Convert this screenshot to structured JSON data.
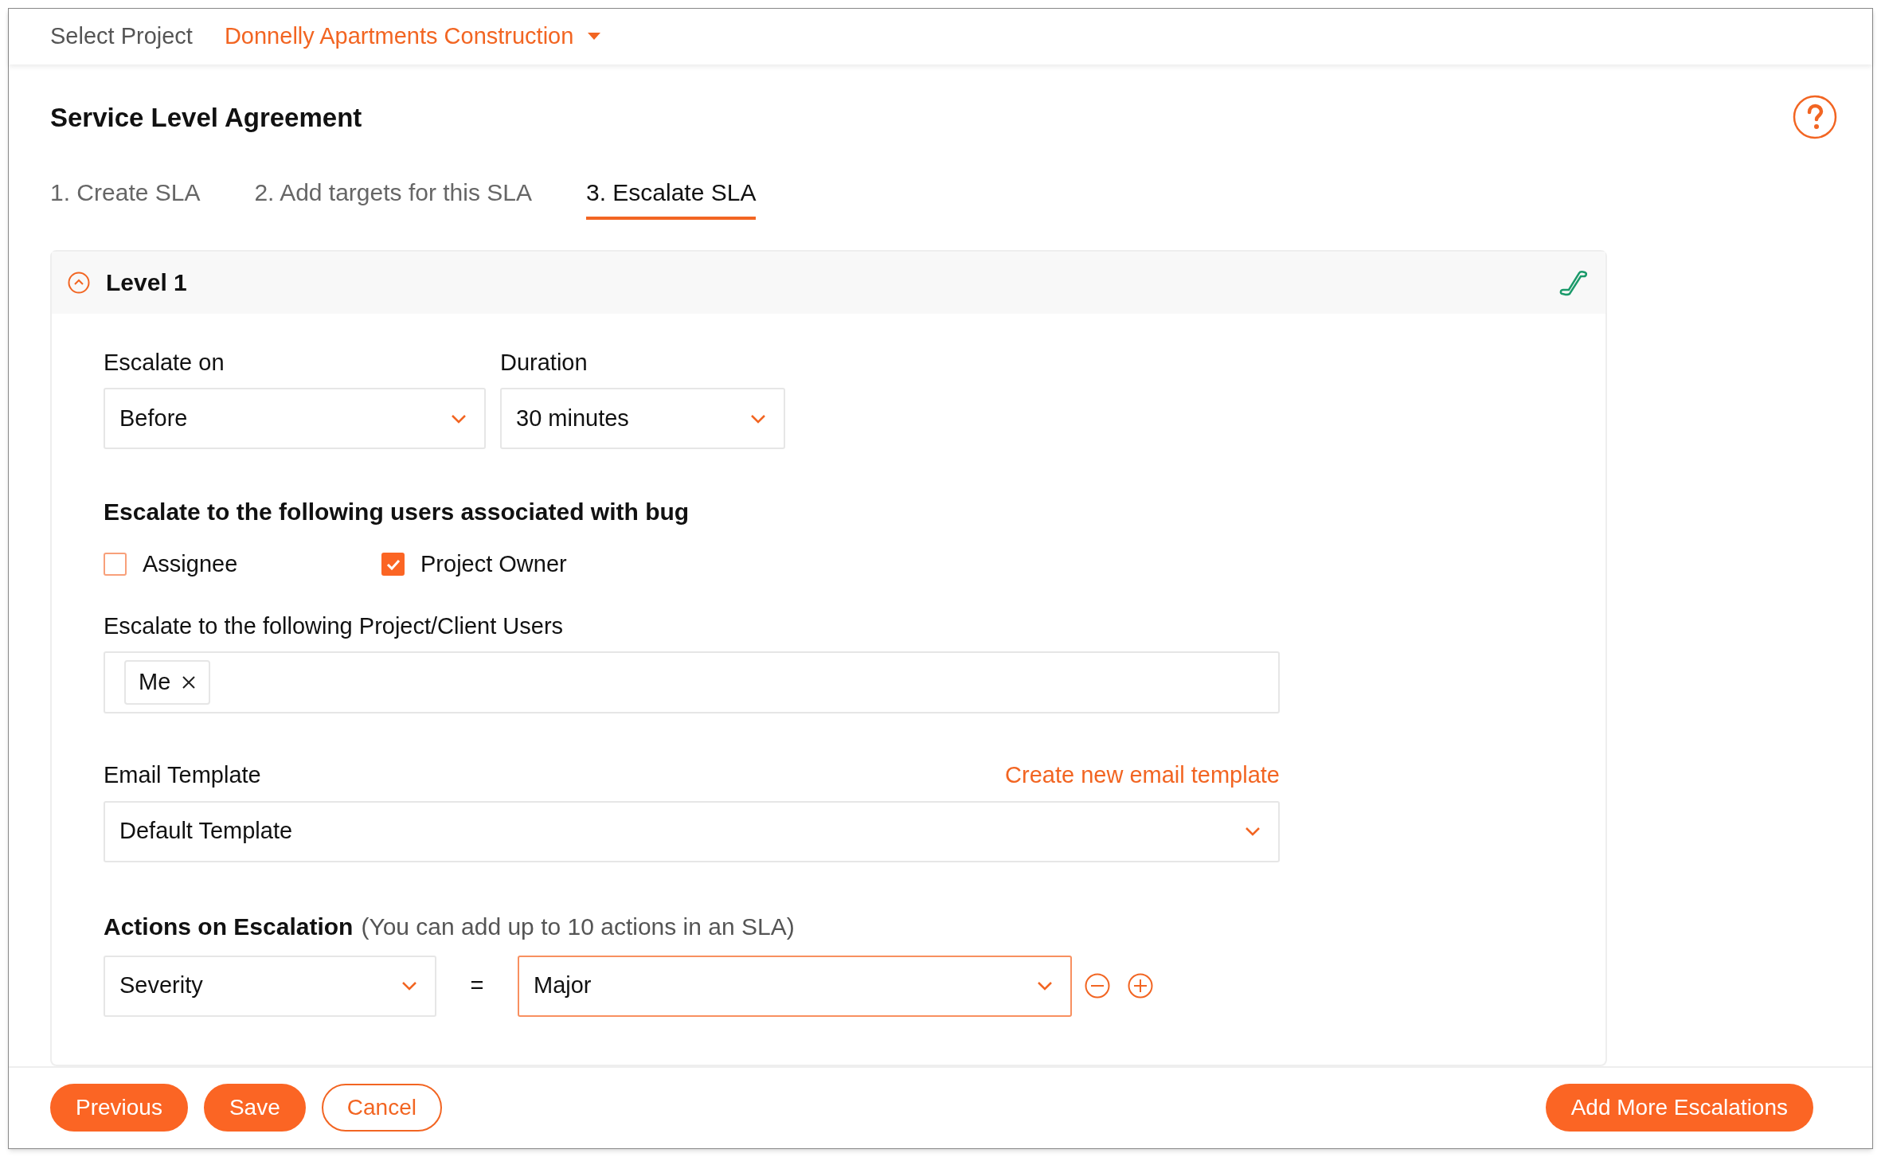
{
  "project_selector": {
    "label": "Select Project",
    "value": "Donnelly Apartments Construction"
  },
  "page_title": "Service Level Agreement",
  "tabs": [
    {
      "label": "1. Create SLA",
      "selected": false
    },
    {
      "label": "2. Add targets for this SLA",
      "selected": false
    },
    {
      "label": "3. Escalate SLA",
      "selected": true
    }
  ],
  "level": {
    "title": "Level 1",
    "expanded": true,
    "escalate_on": {
      "label": "Escalate on",
      "value": "Before"
    },
    "duration": {
      "label": "Duration",
      "value": "30 minutes"
    },
    "users_section": {
      "heading": "Escalate to the following users associated with bug",
      "checkboxes": [
        {
          "label": "Assignee",
          "checked": false
        },
        {
          "label": "Project Owner",
          "checked": true
        }
      ]
    },
    "client_users": {
      "label": "Escalate to the following Project/Client Users",
      "tags": [
        "Me"
      ]
    },
    "email_template": {
      "label": "Email Template",
      "link": "Create new email template",
      "value": "Default Template"
    },
    "actions": {
      "heading": "Actions on Escalation",
      "note": "(You can add up to 10 actions in an SLA)",
      "rows": [
        {
          "field": "Severity",
          "operator": "=",
          "value": "Major",
          "focused": true
        }
      ]
    }
  },
  "buttons": [
    {
      "label": "Previous",
      "kind": "filled"
    },
    {
      "label": "Save",
      "kind": "filled"
    },
    {
      "label": "Cancel",
      "kind": "outline"
    }
  ],
  "add_button": "Add More Escalations"
}
